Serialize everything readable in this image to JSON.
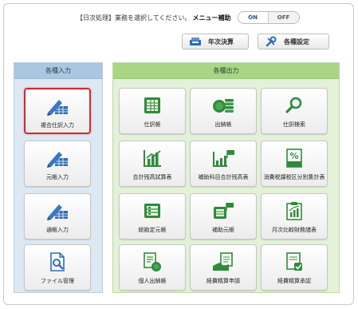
{
  "header": {
    "instruction": "【日次処理】業務を選択してください。",
    "menu_help_label": "メニュー補助",
    "toggle_on": "ON",
    "toggle_off": "OFF"
  },
  "toolbar": {
    "year_end_label": "年次決算",
    "settings_label": "各種設定"
  },
  "input_panel": {
    "title": "各種入力",
    "items": [
      {
        "label": "複合仕訳入力",
        "icon": "pen-ledger-icon"
      },
      {
        "label": "元帳入力",
        "icon": "pen-ledger-icon"
      },
      {
        "label": "通帳入力",
        "icon": "pen-ledger-icon"
      },
      {
        "label": "ファイル管理",
        "icon": "file-search-icon"
      }
    ]
  },
  "output_panel": {
    "title": "各種出力",
    "items": [
      {
        "label": "仕訳帳",
        "icon": "journal-sheet-icon"
      },
      {
        "label": "出納帳",
        "icon": "coin-stack-icon"
      },
      {
        "label": "仕訳検索",
        "icon": "magnifier-icon"
      },
      {
        "label": "合計残高試算表",
        "icon": "bar-chart-icon"
      },
      {
        "label": "補助科目合計残高表",
        "icon": "sub-chart-icon"
      },
      {
        "label": "消費税課税区分別集計表",
        "icon": "percent-icon"
      },
      {
        "label": "総勘定元帳",
        "icon": "ledger-book-icon"
      },
      {
        "label": "補助元帳",
        "icon": "sub-ledger-icon"
      },
      {
        "label": "月次比較財務諸表",
        "icon": "monthly-report-icon"
      },
      {
        "label": "個人出納帳",
        "icon": "personal-cashbook-icon"
      },
      {
        "label": "経費精算申請",
        "icon": "expense-request-icon"
      },
      {
        "label": "経費精算承認",
        "icon": "expense-approve-icon"
      }
    ]
  },
  "colors": {
    "accent_green": "#2e8b3a",
    "accent_blue": "#2f6db5",
    "selected_border": "#d9262c",
    "left_header": "#a9c7e0",
    "right_header": "#a9d585"
  }
}
